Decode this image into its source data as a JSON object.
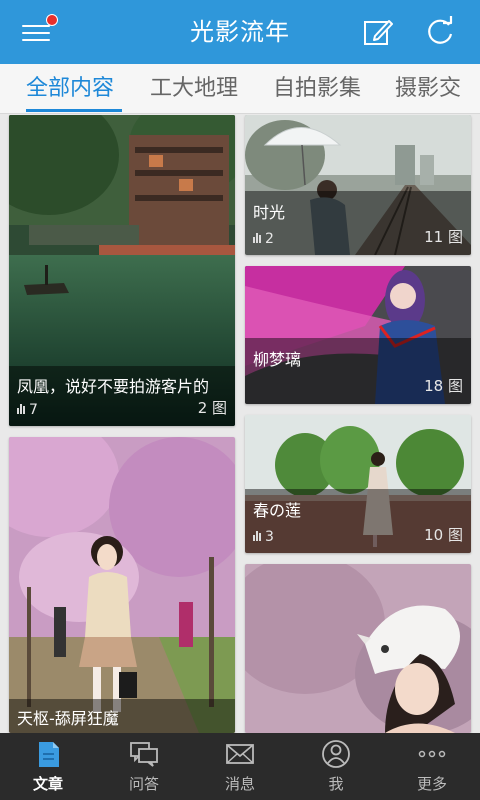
{
  "header": {
    "title": "光影流年",
    "background": "#2f97da"
  },
  "tabs": [
    {
      "label": "全部内容",
      "active": true
    },
    {
      "label": "工大地理",
      "active": false
    },
    {
      "label": "自拍影集",
      "active": false
    },
    {
      "label": "摄影交",
      "active": false
    }
  ],
  "cards": [
    {
      "title": "凤凰，说好不要拍游客片的",
      "views": "7",
      "count": "2 图"
    },
    {
      "title": "时光",
      "views": "2",
      "count": "11 图"
    },
    {
      "title": "柳梦璃",
      "views": "",
      "count": "18 图"
    },
    {
      "title": "春の莲",
      "views": "3",
      "count": "10 图"
    },
    {
      "title": "天枢-舔屏狂魔",
      "views": "",
      "count": ""
    },
    {
      "title": "",
      "views": "",
      "count": ""
    }
  ],
  "bottom_nav": [
    {
      "label": "文章",
      "icon": "article-icon",
      "active": true
    },
    {
      "label": "问答",
      "icon": "qa-icon",
      "active": false
    },
    {
      "label": "消息",
      "icon": "mail-icon",
      "active": false
    },
    {
      "label": "我",
      "icon": "user-icon",
      "active": false
    },
    {
      "label": "更多",
      "icon": "more-icon",
      "active": false
    }
  ],
  "colors": {
    "accent": "#1e88d8",
    "badge": "#e8302c",
    "bottom_bar": "#2b2b2b"
  }
}
